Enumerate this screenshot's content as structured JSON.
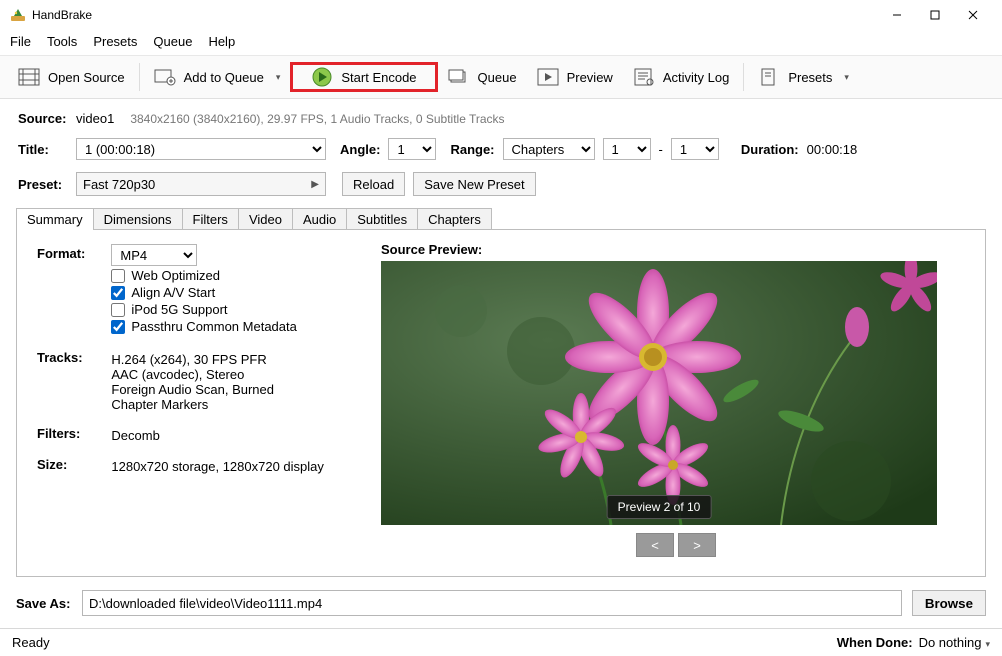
{
  "titlebar": {
    "title": "HandBrake"
  },
  "menubar": [
    "File",
    "Tools",
    "Presets",
    "Queue",
    "Help"
  ],
  "toolbar": {
    "open_source": "Open Source",
    "add_queue": "Add to Queue",
    "start_encode": "Start Encode",
    "queue": "Queue",
    "preview": "Preview",
    "activity_log": "Activity Log",
    "presets": "Presets"
  },
  "source": {
    "label": "Source:",
    "name": "video1",
    "meta": "3840x2160 (3840x2160), 29.97 FPS, 1 Audio Tracks, 0 Subtitle Tracks"
  },
  "title": {
    "label": "Title:",
    "value": "1  (00:00:18)",
    "angle_label": "Angle:",
    "angle": "1",
    "range_label": "Range:",
    "range_mode": "Chapters",
    "range_start": "1",
    "range_sep": "-",
    "range_end": "1",
    "duration_label": "Duration:",
    "duration": "00:00:18"
  },
  "preset": {
    "label": "Preset:",
    "value": "Fast 720p30",
    "reload": "Reload",
    "save_new": "Save New Preset"
  },
  "tabs": [
    "Summary",
    "Dimensions",
    "Filters",
    "Video",
    "Audio",
    "Subtitles",
    "Chapters"
  ],
  "summary": {
    "format_label": "Format:",
    "format": "MP4",
    "web_optimized": "Web Optimized",
    "align_av": "Align A/V Start",
    "ipod": "iPod 5G Support",
    "passthru": "Passthru Common Metadata",
    "tracks_label": "Tracks:",
    "tracks": [
      "H.264 (x264), 30 FPS PFR",
      "AAC (avcodec), Stereo",
      "Foreign Audio Scan, Burned",
      "Chapter Markers"
    ],
    "filters_label": "Filters:",
    "filters": "Decomb",
    "size_label": "Size:",
    "size": "1280x720 storage, 1280x720 display"
  },
  "preview": {
    "title": "Source Preview:",
    "counter": "Preview 2 of 10",
    "prev": "<",
    "next": ">"
  },
  "save": {
    "label": "Save As:",
    "value": "D:\\downloaded file\\video\\Video1111.mp4",
    "browse": "Browse"
  },
  "status": {
    "ready": "Ready",
    "when_done_label": "When Done:",
    "when_done": "Do nothing"
  }
}
